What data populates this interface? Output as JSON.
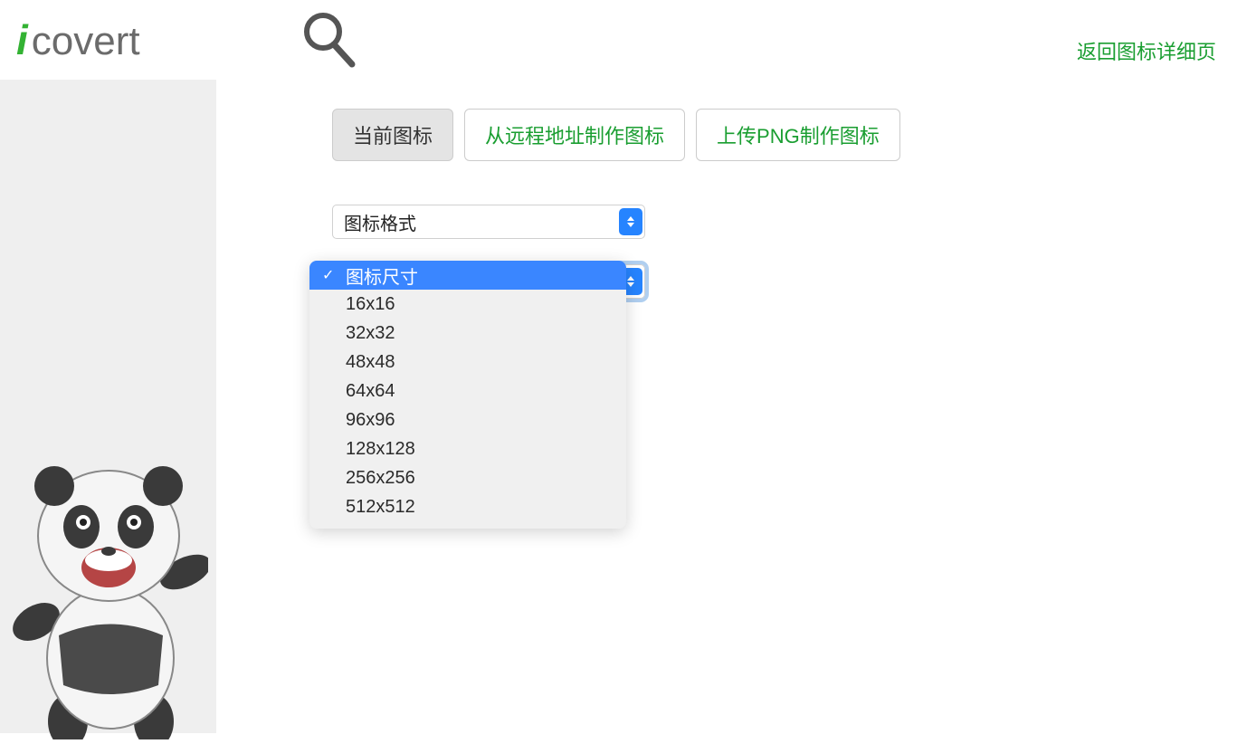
{
  "header": {
    "logo_prefix": "i",
    "logo_text": "covert",
    "back_link": "返回图标详细页"
  },
  "tabs": [
    {
      "label": "当前图标",
      "active": true
    },
    {
      "label": "从远程地址制作图标",
      "active": false
    },
    {
      "label": "上传PNG制作图标",
      "active": false
    }
  ],
  "select_format": {
    "label": "图标格式"
  },
  "select_size": {
    "label": "图标尺寸",
    "options": [
      "图标尺寸",
      "16x16",
      "32x32",
      "48x48",
      "64x64",
      "96x96",
      "128x128",
      "256x256",
      "512x512"
    ],
    "selected_index": 0
  }
}
